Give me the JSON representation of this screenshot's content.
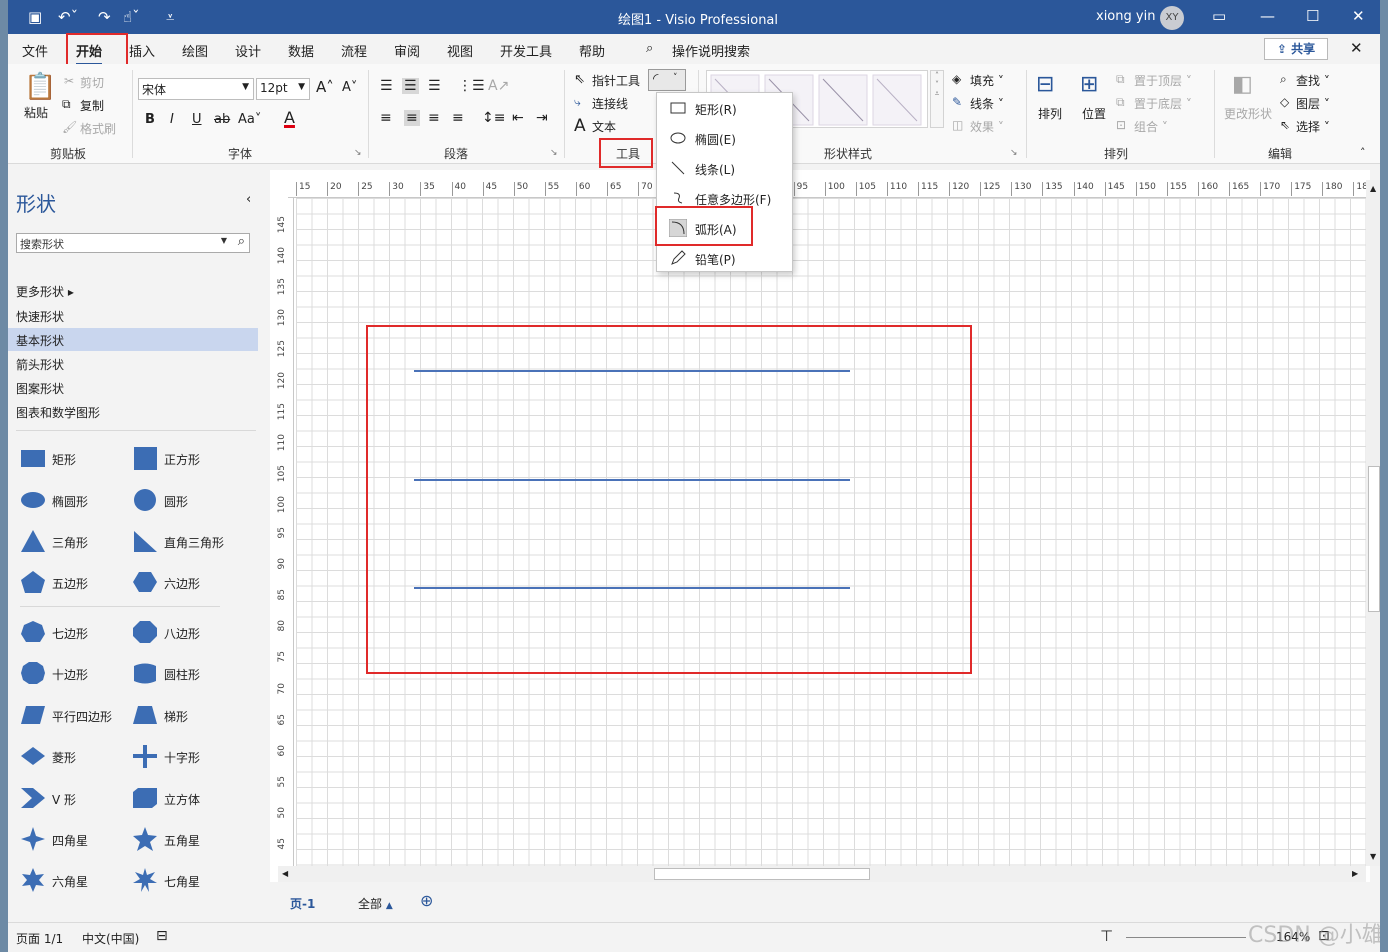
{
  "titlebar": {
    "title": "绘图1  -  Visio Professional",
    "user": "xiong yin",
    "avatar": "XY"
  },
  "tabs": [
    {
      "label": "文件"
    },
    {
      "label": "开始"
    },
    {
      "label": "插入"
    },
    {
      "label": "绘图"
    },
    {
      "label": "设计"
    },
    {
      "label": "数据"
    },
    {
      "label": "流程"
    },
    {
      "label": "审阅"
    },
    {
      "label": "视图"
    },
    {
      "label": "开发工具"
    },
    {
      "label": "帮助"
    },
    {
      "label": "操作说明搜索"
    }
  ],
  "share_label": "共享",
  "ribbon": {
    "clipboard": {
      "paste": "粘贴",
      "cut": "剪切",
      "copy": "复制",
      "format_painter": "格式刷",
      "label": "剪贴板"
    },
    "font": {
      "family": "宋体",
      "size": "12pt",
      "label": "字体",
      "case": "Aa"
    },
    "paragraph": {
      "label": "段落"
    },
    "tools": {
      "pointer": "指针工具",
      "connector": "连接线",
      "text": "文本",
      "label": "工具"
    },
    "shape_styles": {
      "fill": "填充",
      "line": "线条",
      "effects": "效果",
      "label": "形状样式"
    },
    "arrange": {
      "arrange": "排列",
      "position": "位置",
      "bring_front": "置于顶层",
      "send_back": "置于底层",
      "group": "组合",
      "label": "排列"
    },
    "editing": {
      "change_shape": "更改形状",
      "find": "查找",
      "layers": "图层",
      "select": "选择",
      "label": "编辑"
    }
  },
  "dropdown": {
    "items": [
      {
        "label": "矩形(R)"
      },
      {
        "label": "椭圆(E)"
      },
      {
        "label": "线条(L)"
      },
      {
        "label": "任意多边形(F)"
      },
      {
        "label": "弧形(A)"
      },
      {
        "label": "铅笔(P)"
      }
    ]
  },
  "shapes_panel": {
    "title": "形状",
    "search_placeholder": "搜索形状",
    "categories": [
      "更多形状",
      "快速形状",
      "基本形状",
      "箭头形状",
      "图案形状",
      "图表和数学图形"
    ],
    "selected_category": "基本形状",
    "shapes": [
      [
        "矩形",
        "正方形"
      ],
      [
        "椭圆形",
        "圆形"
      ],
      [
        "三角形",
        "直角三角形"
      ],
      [
        "五边形",
        "六边形"
      ],
      [
        "七边形",
        "八边形"
      ],
      [
        "十边形",
        "圆柱形"
      ],
      [
        "平行四边形",
        "梯形"
      ],
      [
        "菱形",
        "十字形"
      ],
      [
        "V 形",
        "立方体"
      ],
      [
        "四角星",
        "五角星"
      ],
      [
        "六角星",
        "七角星"
      ]
    ]
  },
  "ruler_h": [
    "15",
    "20",
    "25",
    "30",
    "35",
    "40",
    "45",
    "50",
    "55",
    "60",
    "65",
    "70",
    "75",
    "80",
    "85",
    "90",
    "95",
    "100",
    "105",
    "110",
    "115",
    "120",
    "125",
    "130",
    "135",
    "140",
    "145",
    "150",
    "155",
    "160",
    "165",
    "170",
    "175",
    "180",
    "18"
  ],
  "ruler_v": [
    "145",
    "140",
    "135",
    "130",
    "125",
    "120",
    "115",
    "110",
    "105",
    "100",
    "95",
    "90",
    "85",
    "80",
    "75",
    "70",
    "65",
    "60",
    "55",
    "50",
    "45"
  ],
  "pagebar": {
    "page": "页-1",
    "all": "全部"
  },
  "statusbar": {
    "page": "页面 1/1",
    "language": "中文(中国)",
    "zoom": "164%",
    "watermark": "CSDN @小雄abc"
  },
  "colors": {
    "accent": "#2b579a",
    "highlight": "#e02a2a",
    "line": "#4a72b8"
  }
}
